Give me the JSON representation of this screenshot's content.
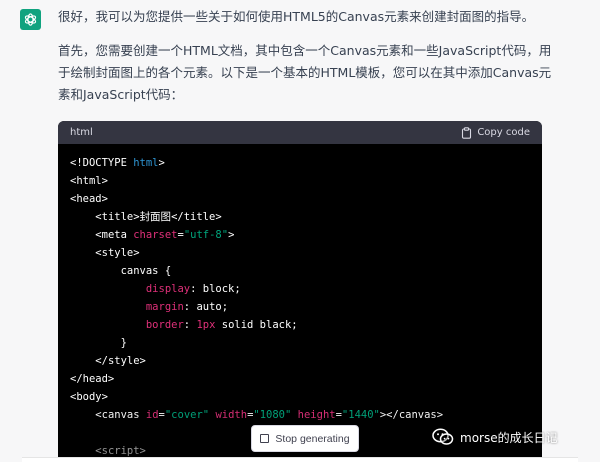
{
  "assistant": {
    "avatar_icon": "openai-logo-icon",
    "avatar_color": "#10a37f",
    "message": {
      "intro": "很好，我可以为您提供一些关于如何使用HTML5的Canvas元素来创建封面图的指导。",
      "body": "首先，您需要创建一个HTML文档，其中包含一个Canvas元素和一些JavaScript代码，用于绘制封面图上的各个元素。以下是一个基本的HTML模板，您可以在其中添加Canvas元素和JavaScript代码："
    }
  },
  "code_block": {
    "language": "html",
    "copy_label": "Copy code",
    "copy_icon": "clipboard-icon",
    "lines": {
      "l1_open": "<!DOCTYPE ",
      "l1_kw": "html",
      "l1_close": ">",
      "l2": "<html>",
      "l3": "<head>",
      "l4_open": "<title>",
      "l4_text": "封面图",
      "l4_close": "</title>",
      "l5_tag": "<meta ",
      "l5_attr": "charset",
      "l5_eq": "=",
      "l5_val": "\"utf-8\"",
      "l5_close": ">",
      "l6": "<style>",
      "l7": "canvas {",
      "l8_prop": "display",
      "l8_val": ": block;",
      "l9_prop": "margin",
      "l9_val": ": auto;",
      "l10_prop": "border",
      "l10_sep": ": ",
      "l10_num": "1px",
      "l10_rest": " solid black;",
      "l11": "}",
      "l12": "</style>",
      "l13": "</head>",
      "l14": "<body>",
      "l15_tag": "<canvas ",
      "l15_a1": "id",
      "l15_v1": "\"cover\"",
      "l15_a2": "width",
      "l15_v2": "\"1080\"",
      "l15_a3": "height",
      "l15_v3": "\"1440\"",
      "l15_close": "></canvas>",
      "l16": "",
      "l17": "<script>"
    }
  },
  "stop_button": {
    "label": "Stop generating",
    "icon": "stop-square-icon"
  },
  "watermark": {
    "icon": "wechat-icon",
    "text": "morse的成长日记"
  }
}
